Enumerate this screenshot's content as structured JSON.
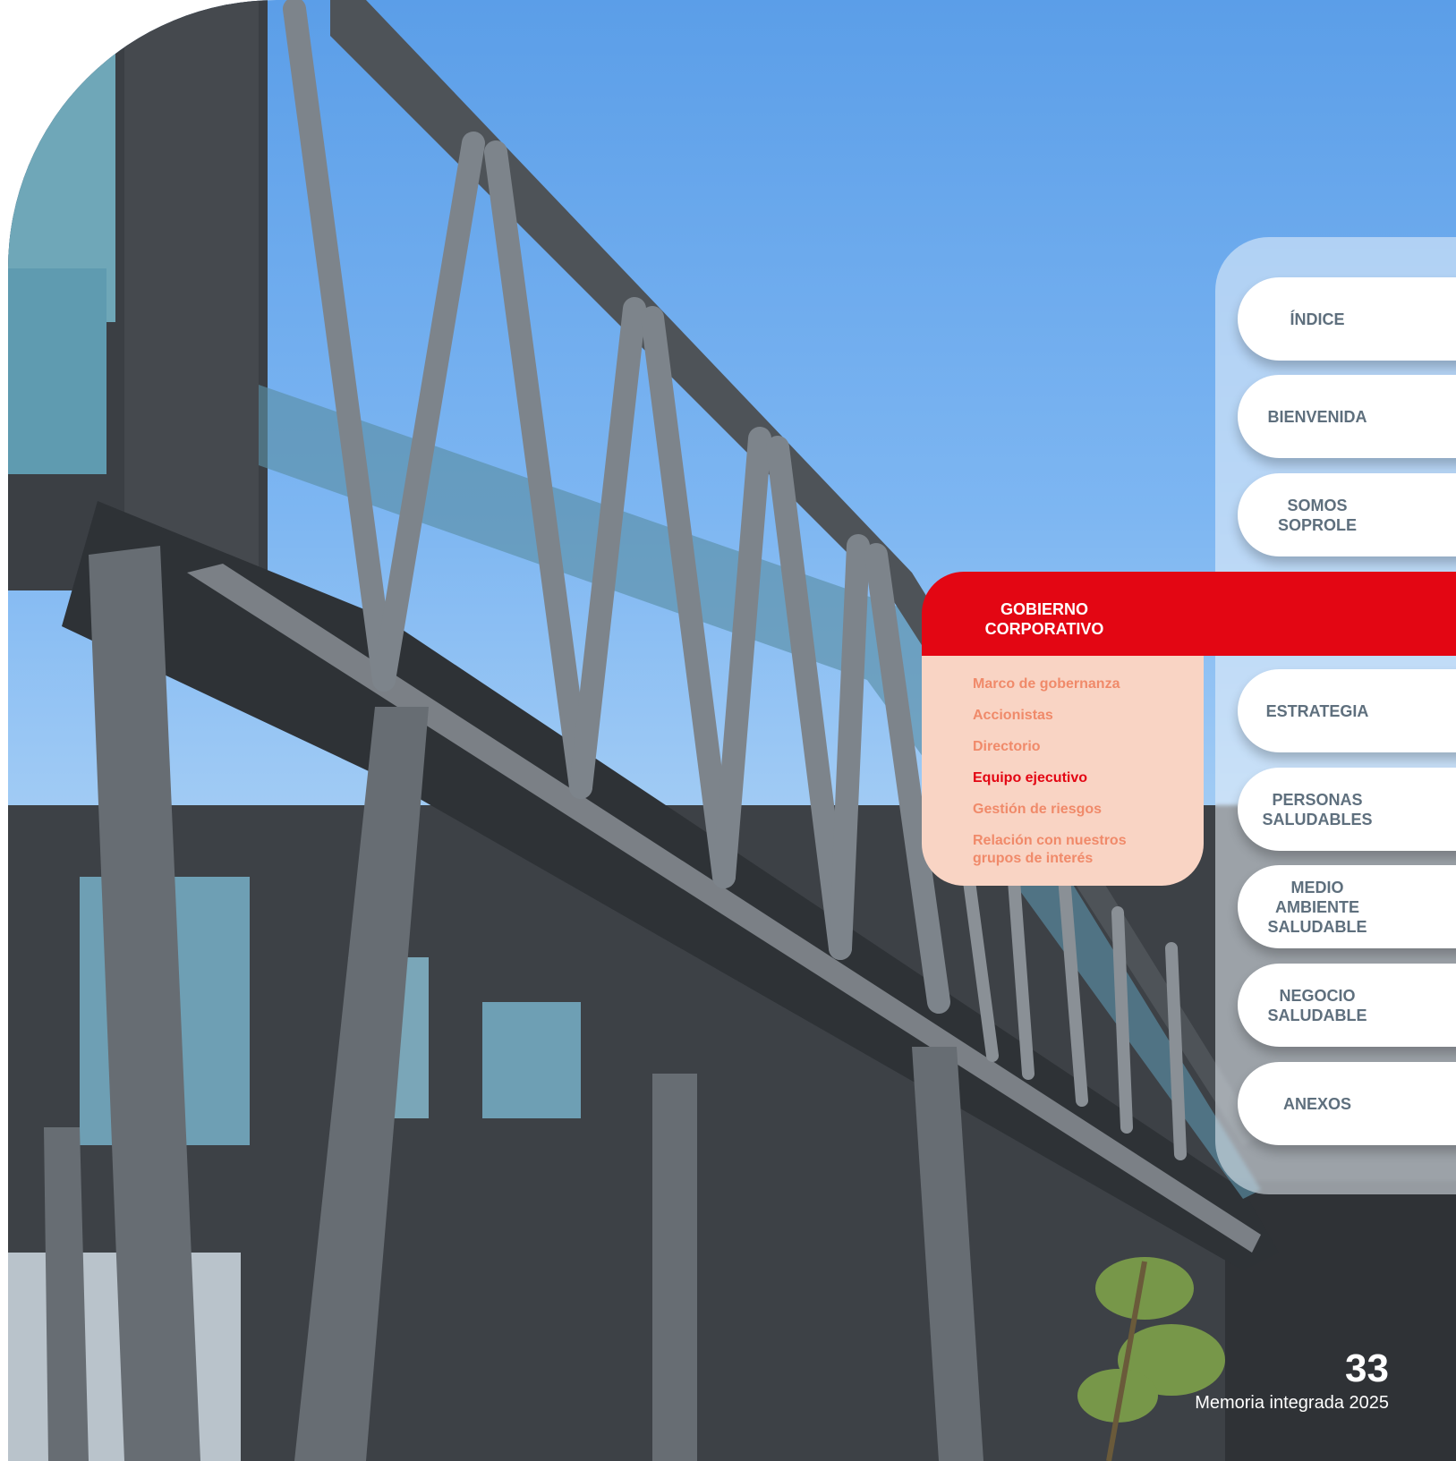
{
  "nav": {
    "items": [
      {
        "label": "ÍNDICE"
      },
      {
        "label": "BIENVENIDA"
      },
      {
        "label": "SOMOS\nSOPROLE"
      },
      {
        "label": "ESTRATEGIA"
      },
      {
        "label": "PERSONAS\nSALUDABLES"
      },
      {
        "label": "MEDIO AMBIENTE\nSALUDABLE"
      },
      {
        "label": "NEGOCIO\nSALUDABLE"
      },
      {
        "label": "ANEXOS"
      }
    ],
    "active": {
      "label": "GOBIERNO\nCORPORATIVO",
      "submenu": [
        "Marco de gobernanza",
        "Accionistas",
        "Directorio",
        "Equipo ejecutivo",
        "Gestión de riesgos",
        "Relación con nuestros\ngrupos de interés"
      ],
      "current_item": "Equipo ejecutivo"
    }
  },
  "footer": {
    "page_number": "33",
    "document_title": "Memoria integrada 2025"
  },
  "colors": {
    "accent": "#e30613",
    "submenu_bg": "#f9d4c4",
    "submenu_text": "#f08a6a",
    "nav_text": "#5e6f7d"
  }
}
